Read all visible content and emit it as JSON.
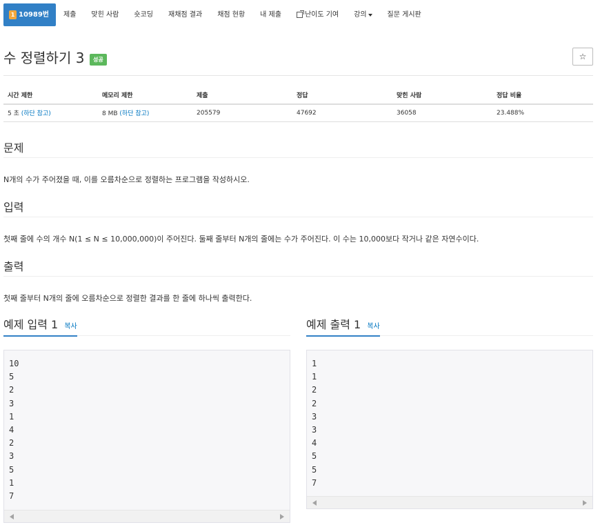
{
  "nav": {
    "items": [
      {
        "label": "10989번",
        "badge": "1",
        "icon": "level-badge-icon",
        "active": true
      },
      {
        "label": "제출"
      },
      {
        "label": "맞힌 사람"
      },
      {
        "label": "숏코딩"
      },
      {
        "label": "재채점 결과"
      },
      {
        "label": "채점 현황"
      },
      {
        "label": "내 제출"
      },
      {
        "label": "난이도 기여",
        "icon": "external-link-icon"
      },
      {
        "label": "강의",
        "icon": "caret-down-icon"
      },
      {
        "label": "질문 게시판"
      }
    ]
  },
  "problem": {
    "title": "수 정렬하기 3",
    "status_badge": "성공",
    "star": "☆"
  },
  "stats": {
    "headers": [
      "시간 제한",
      "메모리 제한",
      "제출",
      "정답",
      "맞힌 사람",
      "정답 비율"
    ],
    "time_limit": "5 초",
    "time_limit_link": "(하단 참고)",
    "memory_limit": "8 MB",
    "memory_limit_link": "(하단 참고)",
    "submissions": "205579",
    "accepted": "47692",
    "solvers": "36058",
    "ratio": "23.488%"
  },
  "sections": {
    "problem_heading": "문제",
    "problem_text": "N개의 수가 주어졌을 때, 이를 오름차순으로 정렬하는 프로그램을 작성하시오.",
    "input_heading": "입력",
    "input_text": "첫째 줄에 수의 개수 N(1 ≤ N ≤ 10,000,000)이 주어진다. 둘째 줄부터 N개의 줄에는 수가 주어진다. 이 수는 10,000보다 작거나 같은 자연수이다.",
    "output_heading": "출력",
    "output_text": "첫째 줄부터 N개의 줄에 오름차순으로 정렬한 결과를 한 줄에 하나씩 출력한다."
  },
  "samples": {
    "input_title": "예제 입력 1",
    "output_title": "예제 출력 1",
    "copy_label": "복사",
    "input_lines": [
      "10",
      "5",
      "2",
      "3",
      "1",
      "4",
      "2",
      "3",
      "5",
      "1",
      "7"
    ],
    "output_lines": [
      "1",
      "1",
      "2",
      "2",
      "3",
      "3",
      "4",
      "5",
      "5",
      "7"
    ]
  },
  "colors": {
    "nav_active": "#3180c6",
    "success_badge": "#5cb85c",
    "link": "#0076c0",
    "level_badge": "#f3a73b"
  }
}
